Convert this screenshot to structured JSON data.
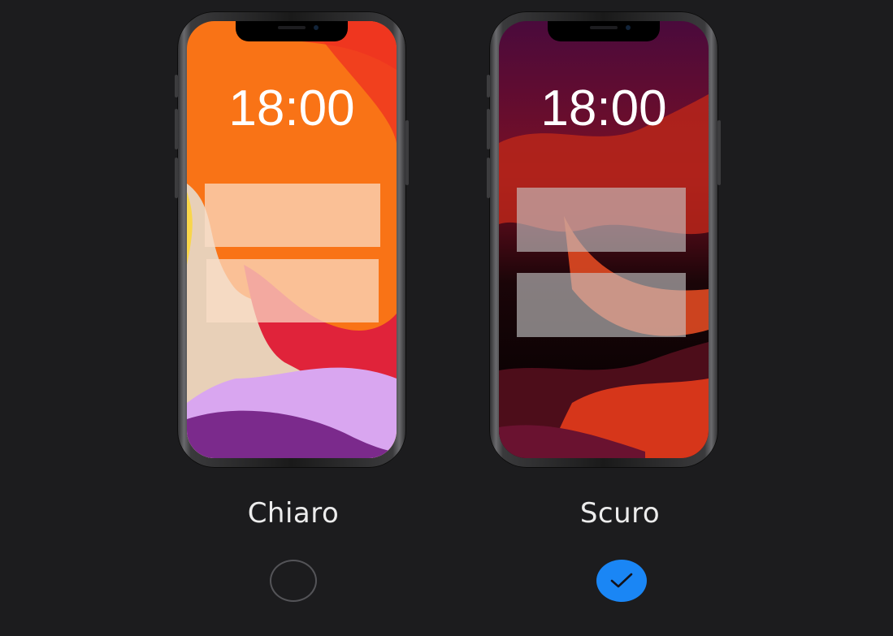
{
  "appearance": {
    "options": [
      {
        "id": "light",
        "label": "Chiaro",
        "time": "18:00",
        "selected": false
      },
      {
        "id": "dark",
        "label": "Scuro",
        "time": "18:00",
        "selected": true
      }
    ],
    "accent_color": "#1a86f5",
    "background_color": "#1c1c1e",
    "check_icon": "checkmark-icon"
  }
}
